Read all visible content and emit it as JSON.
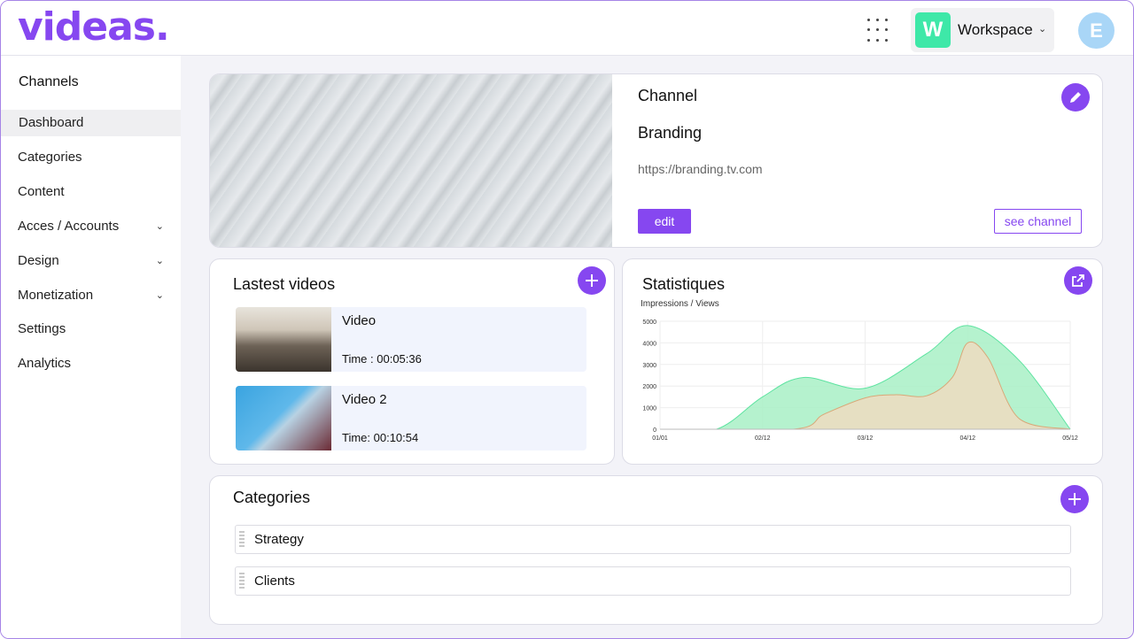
{
  "app": {
    "logo": "videas.",
    "workspace_badge": "W",
    "workspace_label": "Workspace",
    "avatar_letter": "E"
  },
  "sidebar": {
    "title": "Channels",
    "items": [
      {
        "label": "Dashboard"
      },
      {
        "label": "Categories"
      },
      {
        "label": "Content"
      },
      {
        "label": "Acces / Accounts"
      },
      {
        "label": "Design"
      },
      {
        "label": "Monetization"
      },
      {
        "label": "Settings"
      },
      {
        "label": "Analytics"
      }
    ]
  },
  "channel": {
    "label": "Channel",
    "name": "Branding",
    "url": "https://branding.tv.com",
    "edit_label": "edit",
    "see_label": "see channel"
  },
  "latest_videos": {
    "title": "Lastest videos",
    "items": [
      {
        "title": "Video",
        "time": "Time : 00:05:36"
      },
      {
        "title": "Video 2",
        "time": "Time: 00:10:54"
      }
    ]
  },
  "stats": {
    "title": "Statistiques",
    "subtitle": "Impressions / Views"
  },
  "chart_data": {
    "type": "area",
    "x": [
      "01/01",
      "02/12",
      "03/12",
      "04/12",
      "05/12"
    ],
    "ylim": [
      0,
      5000
    ],
    "yticks": [
      "5000",
      "4000",
      "3000",
      "2000",
      "1000",
      "0"
    ],
    "series": [
      {
        "color": "#a8f0c6",
        "stroke": "#5de3a0",
        "x": [
          0,
          0.55,
          1,
          1.4,
          2,
          2.6,
          3,
          3.5,
          4
        ],
        "values": [
          0,
          0,
          1500,
          2400,
          1900,
          3500,
          4800,
          3200,
          0
        ]
      },
      {
        "color": "#efdcc0",
        "stroke": "#d8a878",
        "x": [
          0,
          1.3,
          1.6,
          2,
          2.3,
          2.6,
          2.85,
          3,
          3.2,
          3.5,
          4
        ],
        "values": [
          0,
          0,
          700,
          1450,
          1600,
          1550,
          2400,
          4000,
          3300,
          500,
          0
        ]
      }
    ]
  },
  "categories": {
    "title": "Categories",
    "items": [
      {
        "label": "Strategy"
      },
      {
        "label": "Clients"
      }
    ]
  },
  "colors": {
    "accent": "#8647f0",
    "workspace": "#3ee8a8",
    "avatar": "#a9d6f7"
  }
}
